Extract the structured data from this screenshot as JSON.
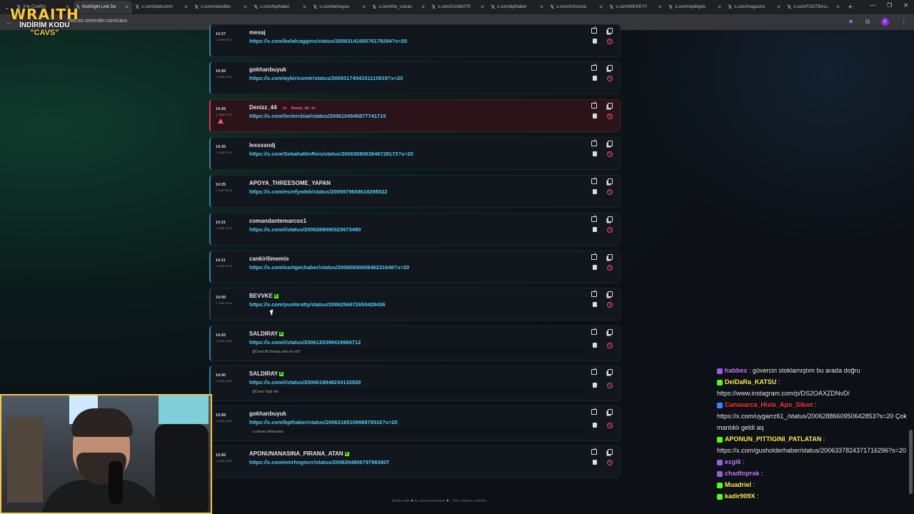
{
  "browser": {
    "tabs": [
      {
        "label": "X'te Conflict",
        "active": false
      },
      {
        "label": "KickSight Link De",
        "active": true
      },
      {
        "label": "x.com/platcomm",
        "active": false
      },
      {
        "label": "x.com/raskolibo",
        "active": false
      },
      {
        "label": "x.com/bpthaber",
        "active": false
      },
      {
        "label": "x.com/berkayav",
        "active": false
      },
      {
        "label": "x.com/the_vulcan",
        "active": false
      },
      {
        "label": "x.com/ConflictTR",
        "active": false
      },
      {
        "label": "x.com/bpthaber",
        "active": false
      },
      {
        "label": "x.com/m3vzu/st",
        "active": false
      },
      {
        "label": "x.com/MIKKEYY",
        "active": false
      },
      {
        "label": "x.com/replikgels",
        "active": false
      },
      {
        "label": "x.com/magazinc",
        "active": false
      },
      {
        "label": "x.com/FOOTBALL",
        "active": false
      }
    ],
    "new_tab": "+",
    "url": "etector.onrender.com/cavs"
  },
  "overlay_logo": {
    "title": "WRAITH",
    "line2": "İNDİRİM KODU",
    "line3": "\"CAVS\""
  },
  "cards": [
    {
      "time": "14:27",
      "ago": "1 saat önce",
      "user": "mesaj",
      "link": "https://x.com/belalcaggins/status/2006314195076178294?s=20",
      "note": "",
      "flag": false,
      "tag": "",
      "tag2": "",
      "kick": false
    },
    {
      "time": "14:26",
      "ago": "1 saat önce",
      "user": "gokhanbuyuk",
      "link": "https://x.com/aykiricomtr/status/2006317454151110919?s=20",
      "note": "",
      "flag": false,
      "tag": "",
      "tag2": "",
      "kick": false
    },
    {
      "time": "14:26",
      "ago": "1 saat önce",
      "user": "Denizz_44",
      "link": "https://x.com/leclercbiat/status/2006104545877741719",
      "note": "",
      "flag": true,
      "tag": "2x",
      "tag2": "Denizz_44 - 2x",
      "kick": false
    },
    {
      "time": "14:25",
      "ago": "1 saat önce",
      "user": "lexsvandj",
      "link": "https://x.com/SebahattinReis/status/2006308063846728173?s=20",
      "note": "",
      "flag": false,
      "tag": "",
      "tag2": "",
      "kick": false
    },
    {
      "time": "14:25",
      "ago": "1 saat önce",
      "user": "APOYA_THREESOME_YAPAN",
      "link": "https://x.com/esrefyedek/status/2005979658618298522",
      "note": "",
      "flag": false,
      "tag": "",
      "tag2": "",
      "kick": false
    },
    {
      "time": "14:21",
      "ago": "1 saat önce",
      "user": "comandantemarcos1",
      "link": "https://x.com/i/status/2006269090323673490",
      "note": "",
      "flag": false,
      "tag": "",
      "tag2": "",
      "kick": false
    },
    {
      "time": "14:11",
      "ago": "1 saat önce",
      "user": "cankirilimemis",
      "link": "https://x.com/ozetgechaber/status/2006060060846231648?s=20",
      "note": "",
      "flag": false,
      "tag": "",
      "tag2": "",
      "kick": false
    },
    {
      "time": "14:09",
      "ago": "1 saat önce",
      "user": "BEVVKE",
      "link": "https://x.com/yumbratty/status/2006256672650428436",
      "note": "",
      "flag": false,
      "tag": "",
      "tag2": "",
      "kick": true
    },
    {
      "time": "14:03",
      "ago": "1 saat önce",
      "user": "SALDIRAY",
      "link": "https://x.com/i/status/2006120399419969712",
      "note": "@Cavs Bu hesap sana mı ait?",
      "flag": false,
      "tag": "",
      "tag2": "",
      "kick": true
    },
    {
      "time": "14:00",
      "ago": "1 saat önce",
      "user": "SALDIRAY",
      "link": "https://x.com/i/status/2006019948234133929",
      "note": "@Cavs Yaşlı efe",
      "flag": false,
      "tag": "",
      "tag2": "",
      "kick": true
    },
    {
      "time": "13:58",
      "ago": "1 saat önce",
      "user": "gokhanbuyuk",
      "link": "https://x.com/bpthaber/status/2006316510998876516?s=20",
      "note": "o zaman damacana",
      "flag": false,
      "tag": "",
      "tag2": "",
      "kick": false
    },
    {
      "time": "13:56",
      "ago": "1 saat önce",
      "user": "APONUNANASINA_PIRANA_ATAN",
      "link": "https://x.com/emrhngncrr/status/2006304806797983807",
      "note": "",
      "flag": false,
      "tag": "",
      "tag2": "",
      "kick": true
    }
  ],
  "footer": {
    "made_with": "Made with",
    "by": "by",
    "author": "atarimuhendisi",
    "rights": "· Tüm hakları saklıdır"
  },
  "chat": [
    {
      "user": "habbes",
      "text": " : güvercin stoklamıştım bu arada doğru",
      "color": "purple"
    },
    {
      "user": "DeiDaRa_KATSU",
      "text": " :",
      "color": "yellow"
    },
    {
      "user": "",
      "text": "https://www.instagram.com/p/DS2OAXZDNvD/",
      "color": "white"
    },
    {
      "user": "Canavarca_Hisle_Apo_Siken",
      "text": " :",
      "color": "red"
    },
    {
      "user": "",
      "text": "https://x.com/uygarrz61_/status/2006288660950642853?s=20 Çok mantıklı geldi aq",
      "color": "white"
    },
    {
      "user": "APONUN_PITTIGINI_PATLATAN",
      "text": " :",
      "color": "yellow"
    },
    {
      "user": "",
      "text": "https://x.com/gusholderhaber/status/2006337824371716296?s=20",
      "color": "white"
    },
    {
      "user": "ezgi6",
      "text": " : ",
      "color": "purple"
    },
    {
      "user": "chadtoprak",
      "text": " : ",
      "color": "purple"
    },
    {
      "user": "Muadriel",
      "text": " : ",
      "color": "yellow"
    },
    {
      "user": "kadir909X",
      "text": " : ",
      "color": "yellow"
    }
  ]
}
